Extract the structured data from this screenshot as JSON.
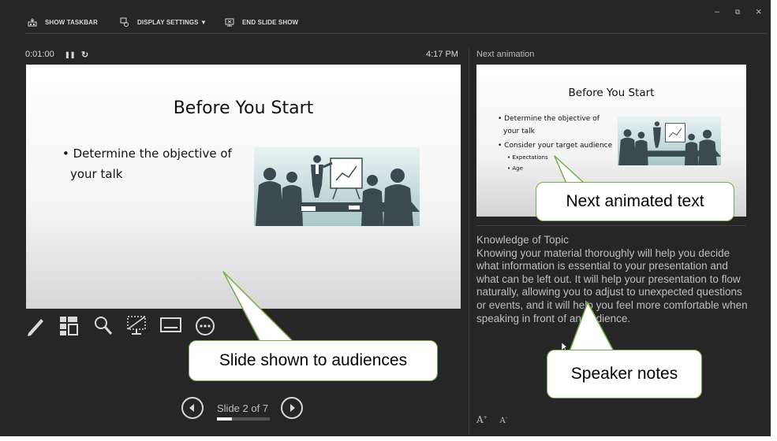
{
  "toolbar": {
    "show_taskbar": "SHOW TASKBAR",
    "display_settings": "DISPLAY SETTINGS ▼",
    "end_slide_show": "END SLIDE SHOW"
  },
  "window_controls": {
    "minimize": "–",
    "restore": "⧉",
    "close": "×"
  },
  "timer": {
    "elapsed": "0:01:00",
    "pause": "❚❚",
    "restart": "↻"
  },
  "clock": "4:17 PM",
  "current_slide": {
    "title": "Before You Start",
    "bullet_line1": "• Determine the objective of",
    "bullet_line2": "your talk"
  },
  "next_panel": {
    "label": "Next animation",
    "slide": {
      "title": "Before You Start",
      "bullet1_line1": "• Determine the objective of",
      "bullet1_line2": "your talk",
      "bullet2": "• Consider your target audience",
      "sub1": "• Expectations",
      "sub2": "• Age"
    }
  },
  "notes": {
    "heading": "Knowledge of Topic",
    "body": "Knowing your material thoroughly will help you decide what information is essential to your presentation and what can be left out. It will help your presentation to flow naturally, allowing you to adjust to unexpected questions or events, and it will help you feel more comfortable when speaking in front of an audience."
  },
  "tools": [
    "pen-icon",
    "all-slides-icon",
    "zoom-icon",
    "black-screen-icon",
    "subtitles-icon",
    "more-options-icon"
  ],
  "navigation": {
    "prev": "◀",
    "next": "▶",
    "slide_counter": "Slide 2 of 7",
    "progress": 0.29
  },
  "font_controls": {
    "increase": "A",
    "decrease": "A"
  },
  "callouts": {
    "next_text": "Next animated text",
    "slide_shown": "Slide shown to audiences",
    "speaker_notes": "Speaker notes"
  },
  "colors": {
    "background": "#262626",
    "callout_border": "#70ad47",
    "text": "#d9d9d9"
  }
}
